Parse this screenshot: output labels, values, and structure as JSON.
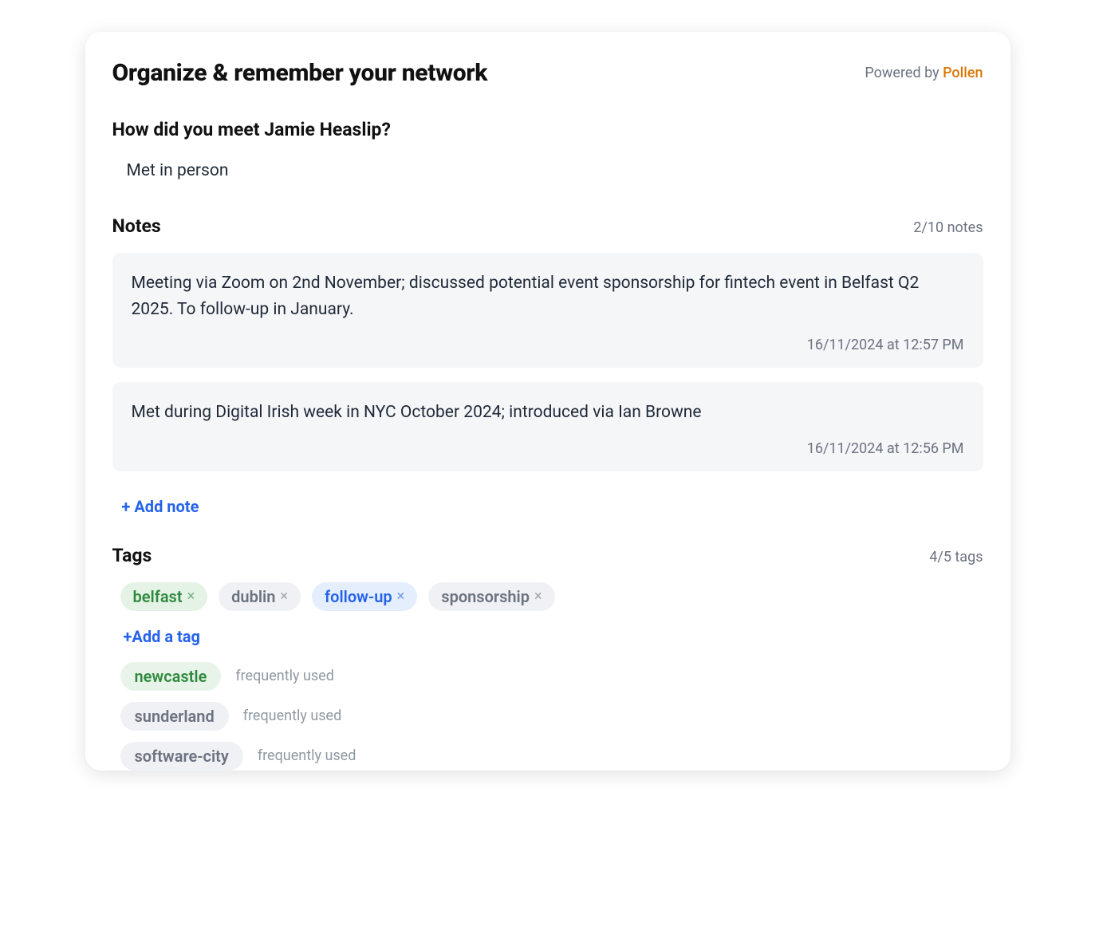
{
  "header": {
    "title": "Organize & remember your network",
    "powered_prefix": "Powered by ",
    "powered_brand": "Pollen"
  },
  "meet": {
    "question": "How did you meet Jamie Heaslip?",
    "answer": "Met in person"
  },
  "notes": {
    "title": "Notes",
    "count": "2/10 notes",
    "items": [
      {
        "text": "Meeting via Zoom on 2nd November; discussed potential event sponsorship for fintech event in Belfast Q2 2025. To follow-up in January.",
        "time": "16/11/2024 at 12:57 PM"
      },
      {
        "text": "Met during Digital Irish week in NYC October 2024; introduced via Ian Browne",
        "time": "16/11/2024 at 12:56 PM"
      }
    ],
    "add_label": "+ Add note"
  },
  "tags": {
    "title": "Tags",
    "count": "4/5 tags",
    "items": [
      {
        "label": "belfast",
        "style": "green"
      },
      {
        "label": "dublin",
        "style": "gray"
      },
      {
        "label": "follow-up",
        "style": "blue"
      },
      {
        "label": "sponsorship",
        "style": "gray"
      }
    ],
    "add_label": "+Add a tag",
    "suggestions": [
      {
        "label": "newcastle",
        "style": "green",
        "hint": "frequently used"
      },
      {
        "label": "sunderland",
        "style": "gray",
        "hint": "frequently used"
      },
      {
        "label": "software-city",
        "style": "gray",
        "hint": "frequently used"
      }
    ]
  }
}
